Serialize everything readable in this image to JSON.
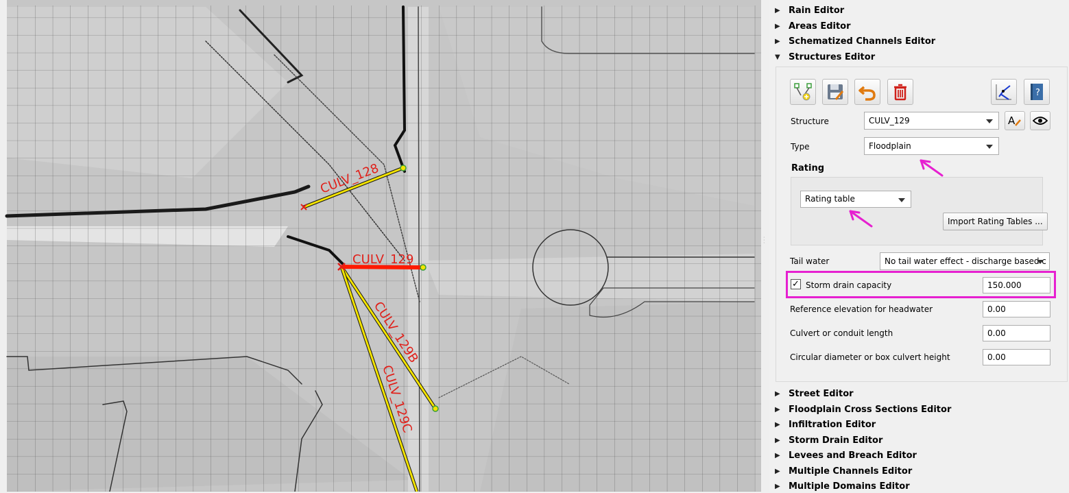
{
  "map": {
    "labels": {
      "culv128": "CULV_128",
      "culv129": "CULV_129",
      "culv129b": "CULV_129B",
      "culv129c": "CULV_129C"
    }
  },
  "panel": {
    "sections_top": [
      "Rain Editor",
      "Areas Editor",
      "Schematized Channels Editor"
    ],
    "open_section": "Structures Editor",
    "sections_bottom": [
      "Street Editor",
      "Floodplain Cross Sections Editor",
      "Infiltration Editor",
      "Storm Drain Editor",
      "Levees and Breach Editor",
      "Multiple Channels Editor",
      "Multiple Domains Editor"
    ],
    "toolbar": {
      "icons": [
        "add-structure-icon",
        "save-icon",
        "undo-icon",
        "delete-icon",
        "schematize-icon",
        "help-book-icon"
      ]
    },
    "structure": {
      "label": "Structure",
      "value": "CULV_129"
    },
    "type": {
      "label": "Type",
      "value": "Floodplain"
    },
    "rating": {
      "heading": "Rating",
      "value": "Rating table",
      "import_button": "Import Rating Tables ..."
    },
    "tail_water": {
      "label": "Tail water",
      "value": "No tail water effect - discharge based c"
    },
    "storm_drain": {
      "label": "Storm drain capacity",
      "checked": true,
      "value": "150.000"
    },
    "ref_elev": {
      "label": "Reference elevation for headwater",
      "value": "0.00"
    },
    "culvert_length": {
      "label": "Culvert or conduit length",
      "value": "0.00"
    },
    "diameter": {
      "label": "Circular diameter or box culvert height",
      "value": "0.00"
    },
    "check_mark": "✓"
  },
  "colors": {
    "highlight": "#e620d0",
    "annotation_arrow": "#e620d0",
    "culvert_line": "#f3e300",
    "culvert_selected": "#ff1a00",
    "label_red": "#e0201a"
  }
}
